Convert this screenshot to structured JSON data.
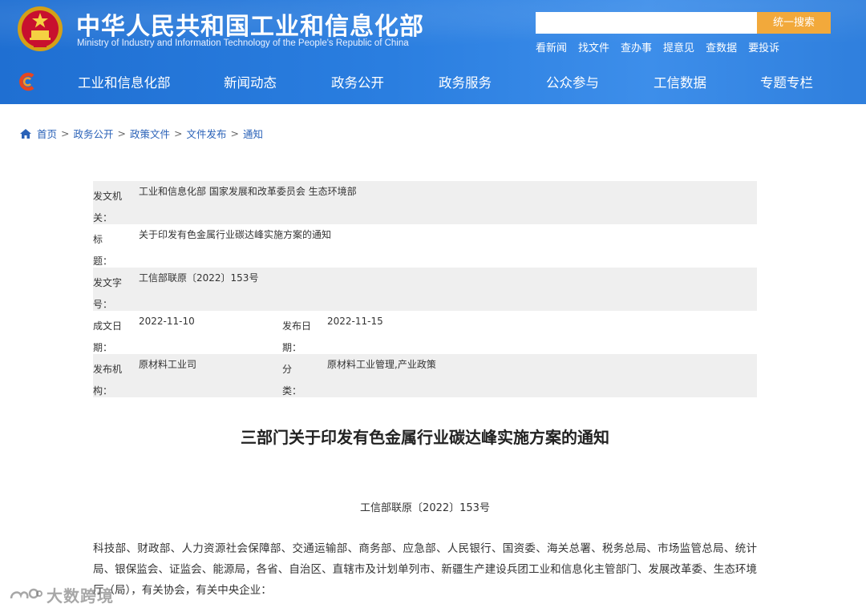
{
  "header": {
    "title": "中华人民共和国工业和信息化部",
    "subtitle": "Ministry of Industry and Information Technology of the People's Republic of China",
    "search": {
      "placeholder": "",
      "button_label": "统一搜索"
    },
    "quick_links": [
      "看新闻",
      "找文件",
      "查办事",
      "提意见",
      "查数据",
      "要投诉"
    ]
  },
  "nav": {
    "items": [
      "工业和信息化部",
      "新闻动态",
      "政务公开",
      "政务服务",
      "公众参与",
      "工信数据",
      "专题专栏"
    ]
  },
  "breadcrumb": [
    "首页",
    "政务公开",
    "政策文件",
    "文件发布",
    "通知"
  ],
  "meta": {
    "issuer_label": "发文机关：",
    "issuer": "工业和信息化部 国家发展和改革委员会 生态环境部",
    "title_label": "标　　题：",
    "title": "关于印发有色金属行业碳达峰实施方案的通知",
    "doc_no_label": "发文字号：",
    "doc_no": "工信部联原〔2022〕153号",
    "written_label": "成文日期：",
    "written_date": "2022-11-10",
    "published_label": "发布日期：",
    "published_date": "2022-11-15",
    "publisher_label": "发布机构：",
    "publisher": "原材料工业司",
    "category_label": "分　　类：",
    "category": "原材料工业管理,产业政策"
  },
  "article": {
    "title": "三部门关于印发有色金属行业碳达峰实施方案的通知",
    "doc_number": "工信部联原〔2022〕153号",
    "recipients": "科技部、财政部、人力资源社会保障部、交通运输部、商务部、应急部、人民银行、国资委、海关总署、税务总局、市场监管总局、统计局、银保监会、证监会、能源局，各省、自治区、直辖市及计划单列市、新疆生产建设兵团工业和信息化主管部门、发展改革委、生态环境厅（局），有关协会，有关中央企业："
  },
  "watermark": "大数跨境",
  "colors": {
    "header_blue": "#2a7ee0",
    "search_orange": "#f2a93b",
    "link_blue": "#2a62b8",
    "meta_shade": "#efefef"
  }
}
